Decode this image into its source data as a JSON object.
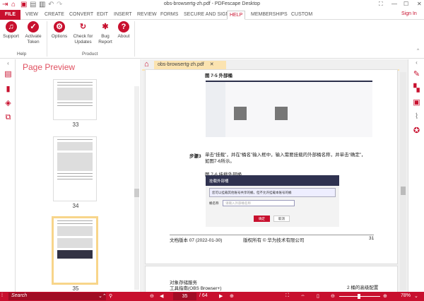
{
  "window": {
    "title": "obs-browsertg-zh.pdf  -  PDFescape Desktop"
  },
  "tabs": [
    "FILE",
    "VIEW",
    "CREATE",
    "CONVERT",
    "EDIT",
    "INSERT",
    "REVIEW",
    "FORMS",
    "SECURE AND SIGN",
    "HELP",
    "MEMBERSHIPS",
    "CUSTOM"
  ],
  "sign_in": "Sign In",
  "ribbon": {
    "buttons": [
      "Support",
      "Activate Token",
      "Options",
      "Check for Updates",
      "Bug Report",
      "About"
    ],
    "groups": [
      "Help",
      "Product"
    ]
  },
  "preview": {
    "title": "Page Preview",
    "pages": [
      "33",
      "34",
      "35"
    ]
  },
  "doc": {
    "tab": "obs-browsertg-zh.pdf",
    "fig5": "图 7-5 外部桶",
    "step_label": "步骤3",
    "step_text": "单击“挂载”，并在“桶名”输入框中，输入需要挂载的外部桶名称，并单击“确定”，如图7-6所示。",
    "fig6": "图 7-6 挂载外部桶",
    "dialog": {
      "title": "挂载外部桶",
      "info": "您可以挂载其他账号共享的桶，但不允许挂载本账号的桶",
      "field": "桶名称",
      "placeholder": "请输入外部桶名称",
      "ok": "确定",
      "cancel": "取消"
    },
    "footer": {
      "version": "文档版本 07 (2022-01-30)",
      "copyright": "版权所有 © 华为技术有限公司",
      "page": "31"
    },
    "next_header": {
      "title": "对象存储服务",
      "subtitle": "工具指南(OBS Browser+)",
      "right": "2 桶的高级配置"
    }
  },
  "status": {
    "search_placeholder": "Search",
    "page": "35",
    "total": "/ 64",
    "zoom": "78%"
  },
  "colors": {
    "accent": "#c8102e",
    "tab_highlight": "#fbe3b0"
  }
}
